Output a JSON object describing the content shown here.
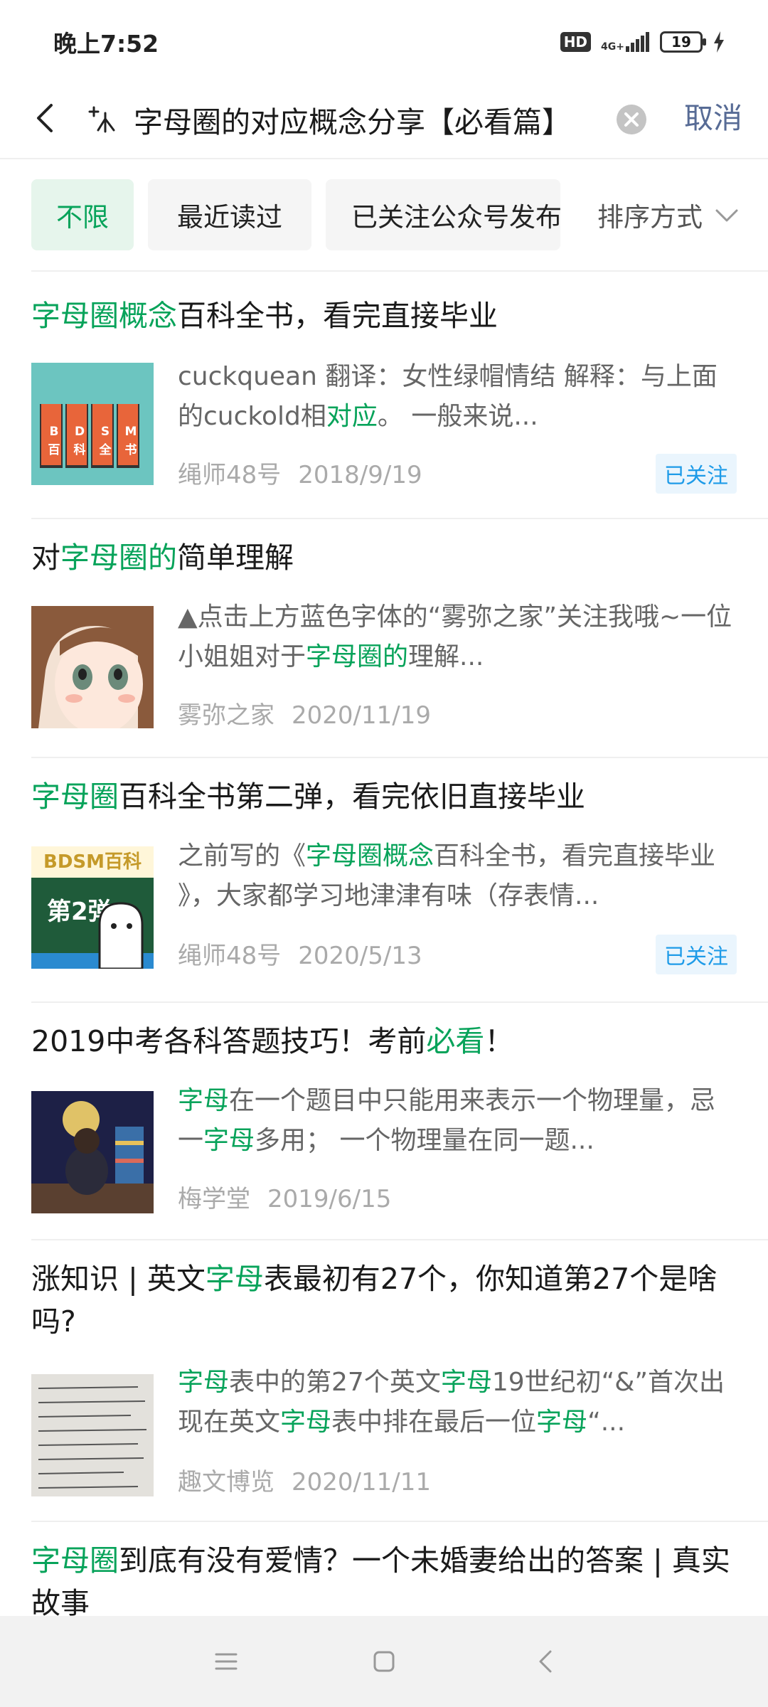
{
  "status_bar": {
    "time": "晚上7:52",
    "hd": "HD",
    "network": "4G+",
    "battery": "19"
  },
  "search": {
    "query": "字母圈的对应概念分享【必看篇】",
    "cancel_label": "取消"
  },
  "filters": {
    "chips": [
      "不限",
      "最近读过",
      "已关注公众号发布"
    ],
    "active_index": 0,
    "sort_label": "排序方式"
  },
  "results": [
    {
      "title_parts": [
        {
          "text": "字母圈概念",
          "hl": true
        },
        {
          "text": "百科全书，看完直接毕业",
          "hl": false
        }
      ],
      "snippet_parts": [
        {
          "text": "cuckquean 翻译：女性绿帽情结 解释：与上面的cuckold相",
          "hl": false
        },
        {
          "text": "对应",
          "hl": true
        },
        {
          "text": "。 一般来说...",
          "hl": false
        }
      ],
      "thumb_text": [
        "B",
        "D",
        "S",
        "M",
        "百",
        "科",
        "全",
        "书"
      ],
      "source": "绳师48号",
      "date": "2018/9/19",
      "followed": "已关注"
    },
    {
      "title_parts": [
        {
          "text": "对",
          "hl": false
        },
        {
          "text": "字母圈的",
          "hl": true
        },
        {
          "text": "简单理解",
          "hl": false
        }
      ],
      "snippet_parts": [
        {
          "text": "▲点击上方蓝色字体的“雾弥之家”关注我哦~一位小姐姐对于",
          "hl": false
        },
        {
          "text": "字母圈的",
          "hl": true
        },
        {
          "text": "理解...",
          "hl": false
        }
      ],
      "source": "雾弥之家",
      "date": "2020/11/19",
      "followed": ""
    },
    {
      "title_parts": [
        {
          "text": "字母圈",
          "hl": true
        },
        {
          "text": "百科全书第二弹，看完依旧直接毕业",
          "hl": false
        }
      ],
      "snippet_parts": [
        {
          "text": "之前写的《",
          "hl": false
        },
        {
          "text": "字母圈概念",
          "hl": true
        },
        {
          "text": "百科全书，看完直接毕业 》，大家都学习地津津有味（存表情...",
          "hl": false
        }
      ],
      "thumb_text": [
        "BDSM百科",
        "第2弹"
      ],
      "source": "绳师48号",
      "date": "2020/5/13",
      "followed": "已关注"
    },
    {
      "title_parts": [
        {
          "text": "2019中考各科答题技巧！考前",
          "hl": false
        },
        {
          "text": "必看",
          "hl": true
        },
        {
          "text": "！",
          "hl": false
        }
      ],
      "snippet_parts": [
        {
          "text": "字母",
          "hl": true
        },
        {
          "text": "在一个题目中只能用来表示一个物理量，忌一",
          "hl": false
        },
        {
          "text": "字母",
          "hl": true
        },
        {
          "text": "多用； 一个物理量在同一题...",
          "hl": false
        }
      ],
      "source": "梅学堂",
      "date": "2019/6/15",
      "followed": ""
    },
    {
      "title_parts": [
        {
          "text": "涨知识 | 英文",
          "hl": false
        },
        {
          "text": "字母",
          "hl": true
        },
        {
          "text": "表最初有27个，你知道第27个是啥吗?",
          "hl": false
        }
      ],
      "snippet_parts": [
        {
          "text": "字母",
          "hl": true
        },
        {
          "text": "表中的第27个英文",
          "hl": false
        },
        {
          "text": "字母",
          "hl": true
        },
        {
          "text": "19世纪初“&”首次出现在英文",
          "hl": false
        },
        {
          "text": "字母",
          "hl": true
        },
        {
          "text": "表中排在最后一位",
          "hl": false
        },
        {
          "text": "字母",
          "hl": true
        },
        {
          "text": "“...",
          "hl": false
        }
      ],
      "source": "趣文博览",
      "date": "2020/11/11",
      "followed": ""
    },
    {
      "title_parts": [
        {
          "text": "字母圈",
          "hl": true
        },
        {
          "text": "到底有没有爱情？一个未婚妻给出的答案 | 真实故事",
          "hl": false
        }
      ],
      "snippet_parts": [],
      "source": "",
      "date": "",
      "followed": ""
    }
  ],
  "colors": {
    "accent_green": "#07a35a",
    "link_blue": "#576b95",
    "followed_blue": "#1e9be8"
  },
  "icons": [
    "back-icon",
    "sparkle-icon",
    "clear-icon",
    "chevron-down-icon",
    "menu-icon",
    "home-icon",
    "nav-back-icon"
  ]
}
